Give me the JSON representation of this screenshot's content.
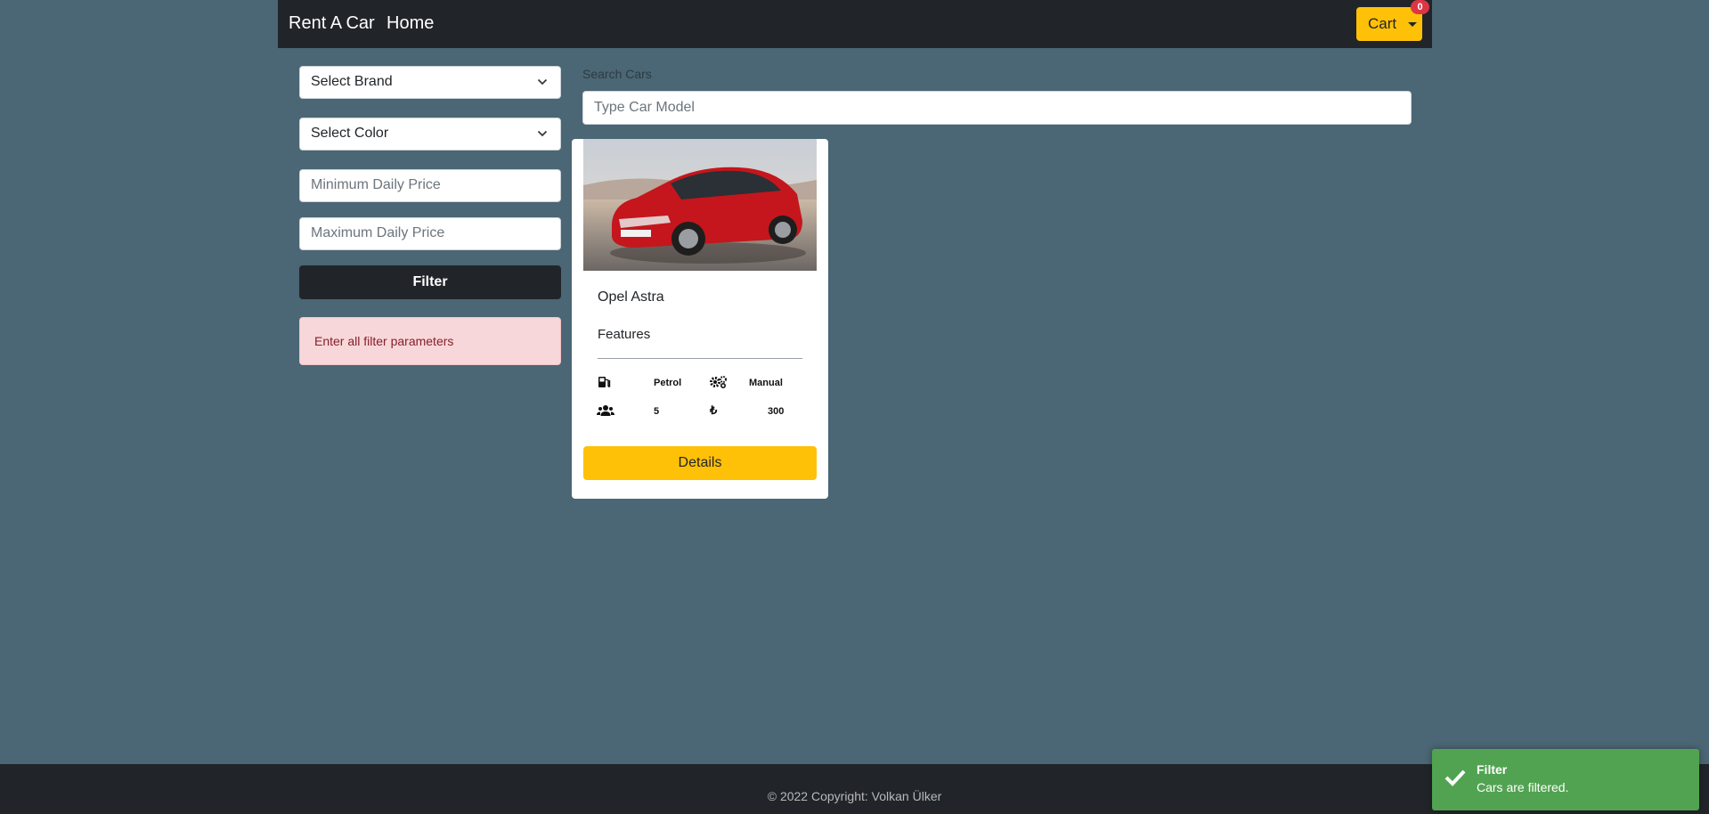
{
  "navbar": {
    "brand": "Rent A Car",
    "home": "Home",
    "cart_label": "Cart",
    "cart_count": "0"
  },
  "filters": {
    "brand_select": "Select Brand",
    "color_select": "Select Color",
    "min_price_placeholder": "Minimum Daily Price",
    "max_price_placeholder": "Maximum Daily Price",
    "filter_button": "Filter",
    "alert": "Enter all filter parameters"
  },
  "search": {
    "label": "Search Cars",
    "placeholder": "Type Car Model"
  },
  "car": {
    "title": "Opel Astra",
    "features_label": "Features",
    "fuel": "Petrol",
    "transmission": "Manual",
    "seats": "5",
    "price": "300",
    "details_button": "Details"
  },
  "footer": {
    "copyright": "© 2022 Copyright: Volkan Ülker"
  },
  "toast": {
    "title": "Filter",
    "message": "Cars are filtered."
  },
  "colors": {
    "background": "#4b6674",
    "dark": "#212529",
    "accent": "#ffc107",
    "danger": "#dc3545",
    "success": "#51a351"
  }
}
